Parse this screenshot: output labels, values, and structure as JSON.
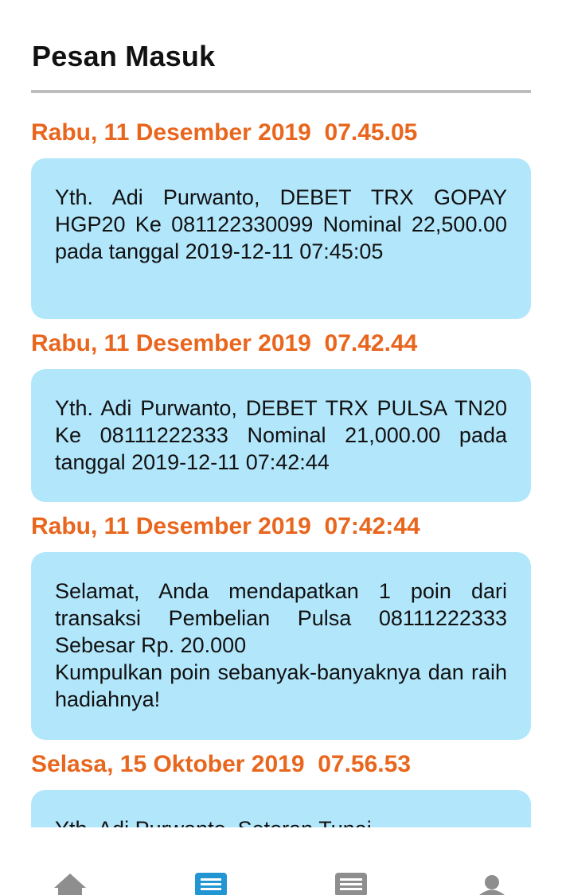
{
  "header": {
    "title": "Pesan Masuk"
  },
  "messages": [
    {
      "date": "Rabu, 11 Desember 2019  07.45.05",
      "text": "Yth. Adi Purwanto, DEBET TRX GOPAY HGP20 Ke 081122330099 Nominal 22,500.00 pada tanggal 2019-12-11 07:45:05"
    },
    {
      "date": "Rabu, 11 Desember 2019  07.42.44",
      "text": "Yth. Adi Purwanto, DEBET TRX PULSA TN20 Ke 08111222333 Nominal 21,000.00 pada tanggal 2019-12-11 07:42:44"
    },
    {
      "date": "Rabu, 11 Desember 2019  07:42:44",
      "text": "Selamat, Anda mendapatkan 1 poin dari transaksi Pembelian Pulsa 08111222333 Sebesar Rp. 20.000\nKumpulkan poin sebanyak-banyaknya dan raih hadiahnya!"
    },
    {
      "date": "Selasa, 15 Oktober 2019  07.56.53",
      "text": "Yth. Adi Purwanto, Setoran Tunai"
    }
  ],
  "bottom_nav": {
    "items": [
      {
        "icon": "home-icon",
        "active": false
      },
      {
        "icon": "inbox-icon",
        "active": true
      },
      {
        "icon": "history-icon",
        "active": false
      },
      {
        "icon": "profile-icon",
        "active": false
      }
    ],
    "active_color": "#2196d3",
    "inactive_color": "#8e8e8e"
  },
  "colors": {
    "date_accent": "#e8661d",
    "bubble_background": "#b2e6fb",
    "divider": "#bdbdbd"
  }
}
